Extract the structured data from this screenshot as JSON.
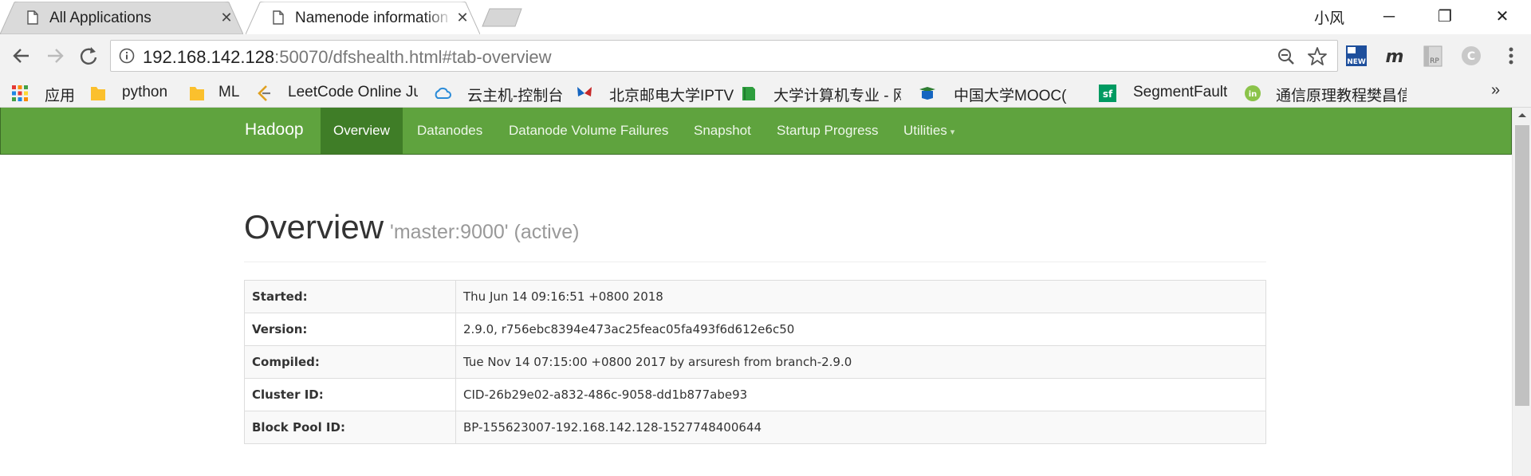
{
  "browser": {
    "tabs": [
      {
        "title": "All Applications",
        "active": false
      },
      {
        "title": "Namenode information",
        "active": true
      }
    ],
    "profile_name": "小风",
    "url": {
      "host": "192.168.142.128",
      "rest": ":50070/dfshealth.html#tab-overview"
    },
    "icons": {
      "back": "arrow-left-icon",
      "forward": "arrow-right-icon",
      "reload": "reload-icon",
      "info": "info-icon",
      "zoom": "zoom-out-icon",
      "star": "star-icon",
      "menu": "kebab-menu-icon"
    },
    "extensions": [
      "NEW",
      "m",
      "RP",
      "C"
    ],
    "window_buttons": {
      "minimize": "─",
      "restore": "❐",
      "close": "✕"
    }
  },
  "bookmarks": [
    {
      "label": "应用",
      "icon": "apps-grid-icon"
    },
    {
      "label": "python",
      "icon": "folder-icon"
    },
    {
      "label": "ML",
      "icon": "folder-icon"
    },
    {
      "label": "LeetCode Online Ju",
      "icon": "leetcode-icon"
    },
    {
      "label": "云主机-控制台",
      "icon": "cloud-icon"
    },
    {
      "label": "北京邮电大学IPTV",
      "icon": "butterfly-icon"
    },
    {
      "label": "大学计算机专业 - 网",
      "icon": "book-icon"
    },
    {
      "label": "中国大学MOOC(慕课",
      "icon": "mooc-icon"
    },
    {
      "label": "SegmentFault",
      "icon": "sf-icon"
    },
    {
      "label": "通信原理教程樊昌信",
      "icon": "green-badge-icon"
    }
  ],
  "bookmarks_more": "»",
  "hadoop_nav": {
    "brand": "Hadoop",
    "items": [
      "Overview",
      "Datanodes",
      "Datanode Volume Failures",
      "Snapshot",
      "Startup Progress",
      "Utilities"
    ],
    "active": "Overview",
    "dropdown_caret": "▾"
  },
  "overview": {
    "title": "Overview",
    "subtitle": "'master:9000' (active)",
    "rows": [
      {
        "label": "Started:",
        "value": "Thu Jun 14 09:16:51 +0800 2018"
      },
      {
        "label": "Version:",
        "value": "2.9.0, r756ebc8394e473ac25feac05fa493f6d612e6c50"
      },
      {
        "label": "Compiled:",
        "value": "Tue Nov 14 07:15:00 +0800 2017 by arsuresh from branch-2.9.0"
      },
      {
        "label": "Cluster ID:",
        "value": "CID-26b29e02-a832-486c-9058-dd1b877abe93"
      },
      {
        "label": "Block Pool ID:",
        "value": "BP-155623007-192.168.142.128-1527748400644"
      }
    ]
  },
  "colors": {
    "hadoop_green": "#5fa33e",
    "hadoop_green_active": "#3f7d27"
  }
}
